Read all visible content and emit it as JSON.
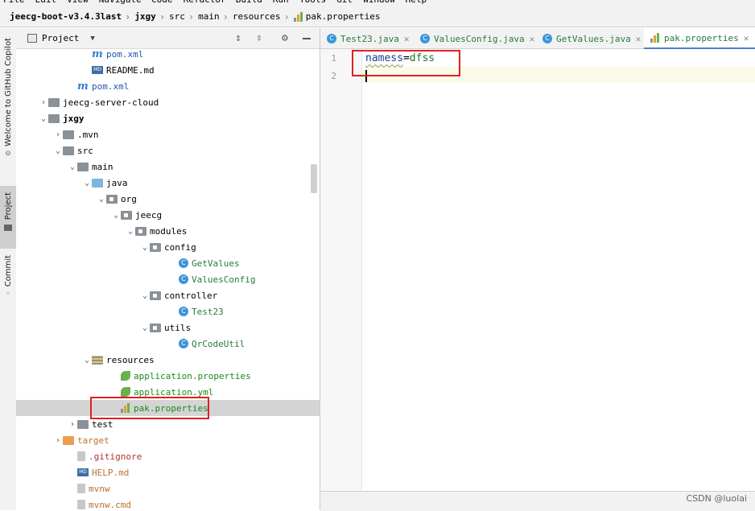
{
  "menu": [
    "File",
    "Edit",
    "View",
    "Navigate",
    "Code",
    "Refactor",
    "Build",
    "Run",
    "Tools",
    "Git",
    "Window",
    "Help"
  ],
  "breadcrumb": [
    "jeecg-boot-v3.4.3last",
    "jxgy",
    "src",
    "main",
    "resources",
    "pak.properties"
  ],
  "left_strip": {
    "copilot": "Welcome to GitHub Copilot",
    "project": "Project",
    "commit": "Commit"
  },
  "project_panel": {
    "title": "Project"
  },
  "tree": [
    {
      "label": "pom.xml",
      "icon": "maven-icon",
      "indent": 4,
      "arrow": "",
      "color": "blue"
    },
    {
      "label": "README.md",
      "icon": "markdown-icon",
      "indent": 4,
      "arrow": "",
      "color": "black"
    },
    {
      "label": "pom.xml",
      "icon": "maven-icon",
      "indent": 3,
      "arrow": "",
      "color": "blue"
    },
    {
      "label": "jeecg-server-cloud",
      "icon": "folder-icon",
      "indent": 1,
      "arrow": "›",
      "color": "black"
    },
    {
      "label": "jxgy",
      "icon": "folder-icon",
      "indent": 1,
      "arrow": "⌄",
      "color": "bold"
    },
    {
      "label": ".mvn",
      "icon": "folder-icon",
      "indent": 2,
      "arrow": "›",
      "color": "black"
    },
    {
      "label": "src",
      "icon": "folder-icon",
      "indent": 2,
      "arrow": "⌄",
      "color": "black"
    },
    {
      "label": "main",
      "icon": "folder-icon",
      "indent": 3,
      "arrow": "⌄",
      "color": "black"
    },
    {
      "label": "java",
      "icon": "source-folder-icon",
      "indent": 4,
      "arrow": "⌄",
      "color": "black"
    },
    {
      "label": "org",
      "icon": "package-icon",
      "indent": 5,
      "arrow": "⌄",
      "color": "black"
    },
    {
      "label": "jeecg",
      "icon": "package-icon",
      "indent": 6,
      "arrow": "⌄",
      "color": "black"
    },
    {
      "label": "modules",
      "icon": "package-icon",
      "indent": 7,
      "arrow": "⌄",
      "color": "black"
    },
    {
      "label": "config",
      "icon": "package-icon",
      "indent": 8,
      "arrow": "⌄",
      "color": "black"
    },
    {
      "label": "GetValues",
      "icon": "class-icon",
      "indent": 10,
      "arrow": "",
      "color": "class"
    },
    {
      "label": "ValuesConfig",
      "icon": "class-icon",
      "indent": 10,
      "arrow": "",
      "color": "class"
    },
    {
      "label": "controller",
      "icon": "package-icon",
      "indent": 8,
      "arrow": "⌄",
      "color": "black"
    },
    {
      "label": "Test23",
      "icon": "class-icon",
      "indent": 10,
      "arrow": "",
      "color": "class"
    },
    {
      "label": "utils",
      "icon": "package-icon",
      "indent": 8,
      "arrow": "⌄",
      "color": "black"
    },
    {
      "label": "QrCodeUtil",
      "icon": "class-icon",
      "indent": 10,
      "arrow": "",
      "color": "class"
    },
    {
      "label": "resources",
      "icon": "resources-folder-icon",
      "indent": 4,
      "arrow": "⌄",
      "color": "black"
    },
    {
      "label": "application.properties",
      "icon": "spring-leaf-icon",
      "indent": 6,
      "arrow": "",
      "color": "green"
    },
    {
      "label": "application.yml",
      "icon": "spring-leaf-icon",
      "indent": 6,
      "arrow": "",
      "color": "green"
    },
    {
      "label": "pak.properties",
      "icon": "properties-icon",
      "indent": 6,
      "arrow": "",
      "color": "green",
      "selected": true
    },
    {
      "label": "test",
      "icon": "folder-icon",
      "indent": 3,
      "arrow": "›",
      "color": "black"
    },
    {
      "label": "target",
      "icon": "excluded-folder-icon",
      "indent": 2,
      "arrow": "›",
      "color": "orange"
    },
    {
      "label": ".gitignore",
      "icon": "file-icon",
      "indent": 3,
      "arrow": "",
      "color": "red"
    },
    {
      "label": "HELP.md",
      "icon": "markdown-icon",
      "indent": 3,
      "arrow": "",
      "color": "orange"
    },
    {
      "label": "mvnw",
      "icon": "file-icon",
      "indent": 3,
      "arrow": "",
      "color": "orange"
    },
    {
      "label": "mvnw.cmd",
      "icon": "file-icon",
      "indent": 3,
      "arrow": "",
      "color": "orange"
    }
  ],
  "tabs": [
    {
      "label": "Test23.java",
      "icon": "class-icon",
      "color": "#287a3c"
    },
    {
      "label": "ValuesConfig.java",
      "icon": "class-icon",
      "color": "#287a3c"
    },
    {
      "label": "GetValues.java",
      "icon": "class-icon",
      "color": "#287a3c"
    },
    {
      "label": "pak.properties",
      "icon": "properties-icon",
      "color": "#287a3c",
      "active": true
    }
  ],
  "editor": {
    "line_numbers": [
      "1",
      "2"
    ],
    "key": "namess",
    "eq": "=",
    "value": "dfss"
  },
  "watermark": "CSDN @luolai",
  "colors": {
    "accent": "#4a83c8",
    "highlight": "#e02020",
    "selection": "#d4d4d4"
  }
}
